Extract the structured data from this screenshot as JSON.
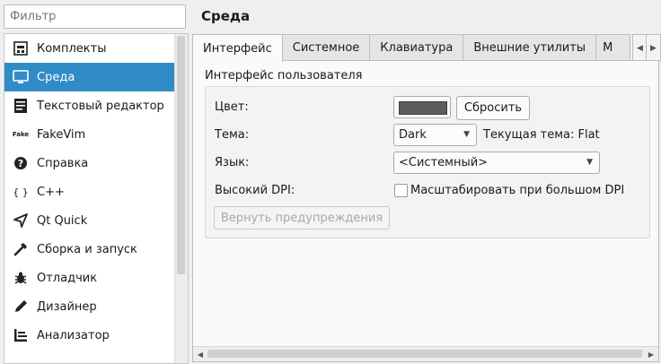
{
  "filter": {
    "placeholder": "Фильтр"
  },
  "sidebar": {
    "items": [
      {
        "label": "Комплекты",
        "icon": "kits-icon",
        "selected": false
      },
      {
        "label": "Среда",
        "icon": "monitor-icon",
        "selected": true
      },
      {
        "label": "Текстовый редактор",
        "icon": "text-editor-icon",
        "selected": false
      },
      {
        "label": "FakeVim",
        "icon": "fakevim-icon",
        "icon_text": "Fake",
        "selected": false
      },
      {
        "label": "Справка",
        "icon": "help-icon",
        "selected": false
      },
      {
        "label": "C++",
        "icon": "braces-icon",
        "icon_text": "{ }",
        "selected": false
      },
      {
        "label": "Qt Quick",
        "icon": "qt-quick-icon",
        "selected": false
      },
      {
        "label": "Сборка и запуск",
        "icon": "hammer-icon",
        "selected": false
      },
      {
        "label": "Отладчик",
        "icon": "bug-icon",
        "selected": false
      },
      {
        "label": "Дизайнер",
        "icon": "pencil-icon",
        "selected": false
      },
      {
        "label": "Анализатор",
        "icon": "analyzer-icon",
        "selected": false
      }
    ]
  },
  "header": {
    "title": "Среда"
  },
  "tabs": [
    {
      "label": "Интерфейс",
      "active": true
    },
    {
      "label": "Системное",
      "active": false
    },
    {
      "label": "Клавиатура",
      "active": false
    },
    {
      "label": "Внешние утилиты",
      "active": false
    },
    {
      "label": "М",
      "active": false
    }
  ],
  "panel": {
    "group_title": "Интерфейс пользователя",
    "color_label": "Цвет:",
    "color_value": "#5c5c5c",
    "reset_button": "Сбросить",
    "theme_label": "Тема:",
    "theme_value": "Dark",
    "current_theme": "Текущая тема: Flat",
    "language_label": "Язык:",
    "language_value": "<Системный>",
    "dpi_label": "Высокий DPI:",
    "dpi_checkbox_label": "Масштабировать при большом DPI",
    "dpi_checked": false,
    "reset_warnings_button": "Вернуть предупреждения"
  },
  "colors": {
    "selection": "#308cc6",
    "accent_text": "#ffffff"
  }
}
